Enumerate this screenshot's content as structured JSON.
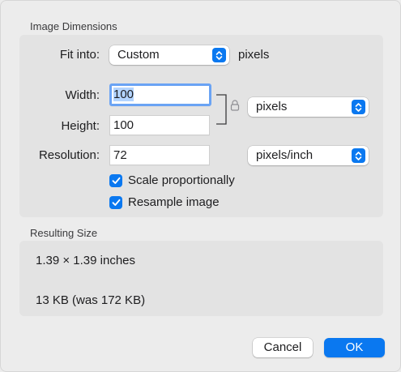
{
  "image_dimensions": {
    "title": "Image Dimensions",
    "fit_into": {
      "label": "Fit into:",
      "value": "Custom",
      "unit_text": "pixels"
    },
    "width": {
      "label": "Width:",
      "value": "100"
    },
    "height": {
      "label": "Height:",
      "value": "100"
    },
    "size_unit": {
      "value": "pixels"
    },
    "resolution": {
      "label": "Resolution:",
      "value": "72",
      "unit": "pixels/inch"
    },
    "scale_proportionally": {
      "label": "Scale proportionally",
      "checked": true
    },
    "resample_image": {
      "label": "Resample image",
      "checked": true
    }
  },
  "resulting_size": {
    "title": "Resulting Size",
    "dimensions": "1.39 × 1.39 inches",
    "file_size": "13 KB (was 172 KB)"
  },
  "buttons": {
    "cancel": "Cancel",
    "ok": "OK"
  },
  "colors": {
    "accent": "#0a78f0",
    "background": "#ececec",
    "group_background": "#e3e3e3",
    "focus_ring": "#6aa3f4"
  },
  "icons": {
    "popup": "chevron-up-down-icon",
    "lock": "lock-icon",
    "checkbox": "checkmark-icon"
  }
}
